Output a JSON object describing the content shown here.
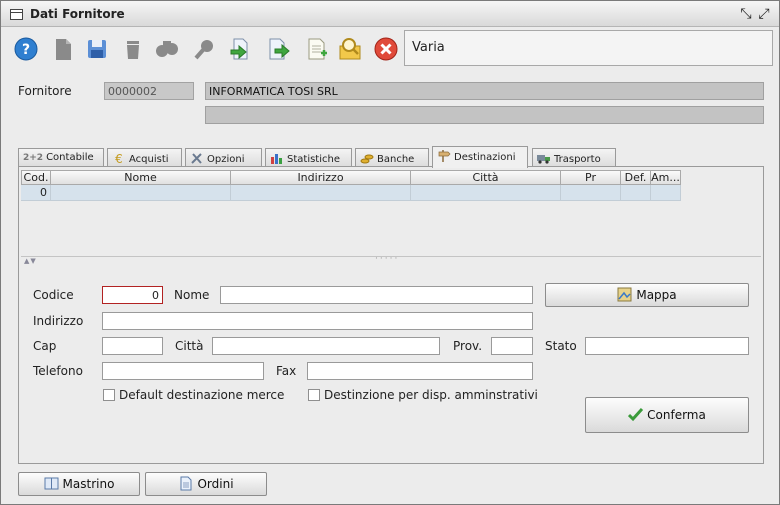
{
  "window": {
    "title": "Dati Fornitore"
  },
  "toolbar": {
    "tools": [
      {
        "icon": "help-icon"
      },
      {
        "icon": "document-icon"
      },
      {
        "icon": "save-icon"
      },
      {
        "icon": "trash-icon"
      },
      {
        "icon": "binoculars-icon"
      },
      {
        "icon": "search-icon"
      },
      {
        "icon": "import-icon"
      },
      {
        "icon": "export-icon"
      },
      {
        "icon": "new-document-icon"
      },
      {
        "icon": "lookup-icon"
      },
      {
        "icon": "close-icon"
      }
    ],
    "category": "Varia"
  },
  "supplier": {
    "label": "Fornitore",
    "code": "0000002",
    "name": "INFORMATICA TOSI SRL",
    "name2": ""
  },
  "tabs": [
    {
      "prefix": "2+2",
      "label": "Contabile"
    },
    {
      "prefix": "",
      "label": "Acquisti"
    },
    {
      "prefix": "",
      "label": "Opzioni"
    },
    {
      "prefix": "",
      "label": "Statistiche"
    },
    {
      "prefix": "",
      "label": "Banche"
    },
    {
      "prefix": "",
      "label": "Destinazioni"
    },
    {
      "prefix": "",
      "label": "Trasporto"
    }
  ],
  "active_tab": "Destinazioni",
  "table": {
    "columns": [
      "Cod.",
      "Nome",
      "Indirizzo",
      "Città",
      "Pr",
      "Def.",
      "Am..."
    ],
    "rows": [
      [
        "0",
        "",
        "",
        "",
        "",
        "",
        ""
      ]
    ]
  },
  "form": {
    "codice_label": "Codice",
    "codice_value": "0",
    "nome_label": "Nome",
    "nome_value": "",
    "indirizzo_label": "Indirizzo",
    "indirizzo_value": "",
    "cap_label": "Cap",
    "cap_value": "",
    "citta_label": "Città",
    "citta_value": "",
    "prov_label": "Prov.",
    "prov_value": "",
    "stato_label": "Stato",
    "stato_value": "",
    "telefono_label": "Telefono",
    "telefono_value": "",
    "fax_label": "Fax",
    "fax_value": "",
    "default_label": "Default destinazione merce",
    "admin_label": "Destinzione per disp. amminstrativi",
    "mappa_label": "Mappa",
    "conferma_label": "Conferma"
  },
  "footer": {
    "mastrino_label": "Mastrino",
    "ordini_label": "Ordini"
  }
}
